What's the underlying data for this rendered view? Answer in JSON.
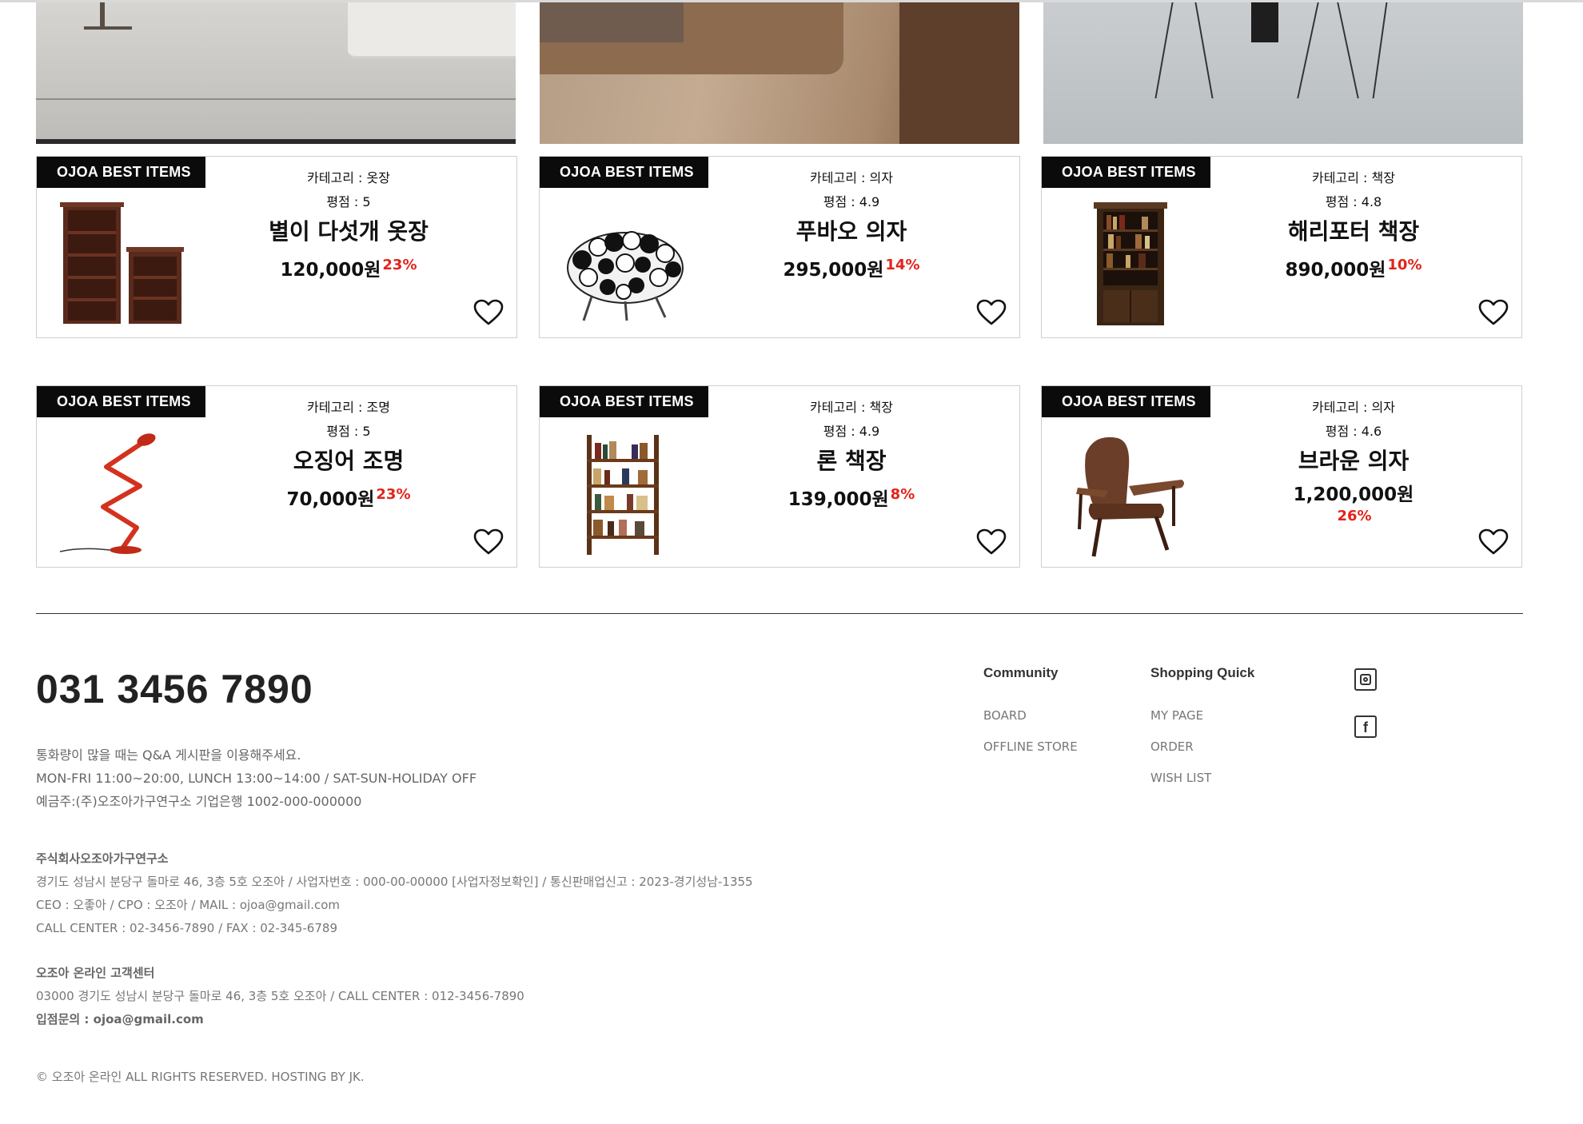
{
  "badge_label": "OJOA BEST ITEMS",
  "colors": {
    "discount": "#e2231a",
    "badge_bg": "#0b0b0b",
    "text": "#222222"
  },
  "products": [
    {
      "category": "카테고리 : 옷장",
      "rating": "평점 : 5",
      "name": "별이 다섯개 옷장",
      "price": "120,000원",
      "discount": "23%",
      "image": "bookcase-pair"
    },
    {
      "category": "카테고리 : 의자",
      "rating": "평점 : 4.9",
      "name": "푸바오 의자",
      "price": "295,000원",
      "discount": "14%",
      "image": "panda-chair"
    },
    {
      "category": "카테고리 : 책장",
      "rating": "평점 : 4.8",
      "name": "해리포터 책장",
      "price": "890,000원",
      "discount": "10%",
      "image": "antique-bookcase"
    },
    {
      "category": "카테고리 : 조명",
      "rating": "평점 : 5",
      "name": "오징어 조명",
      "price": "70,000원",
      "discount": "23%",
      "image": "zigzag-lamp"
    },
    {
      "category": "카테고리 : 책장",
      "rating": "평점 : 4.9",
      "name": "론 책장",
      "price": "139,000원",
      "discount": "8%",
      "image": "open-bookshelf"
    },
    {
      "category": "카테고리 : 의자",
      "rating": "평점 : 4.6",
      "name": "브라운 의자",
      "price": "1,200,000원",
      "discount": "26%",
      "image": "leather-armchair"
    }
  ],
  "footer": {
    "phone": "031 3456 7890",
    "notice": "통화량이 많을 때는 Q&A 게시판을 이용해주세요.",
    "hours": "MON-FRI 11:00~20:00, LUNCH 13:00~14:00 / SAT-SUN-HOLIDAY OFF",
    "bank": "예금주:(주)오조아가구연구소 기업은행 1002-000-000000",
    "company_name": "주식회사오조아가구연구소",
    "company_address": "경기도 성남시 분당구 돌마로 46, 3층 5호 오조아 / 사업자번호 : 000-00-00000 [사업자정보확인] / 통신판매업신고 : 2023-경기성남-1355",
    "company_ceo": "CEO : 오좋아 / CPO : 오조아 / MAIL : ojoa@gmail.com",
    "company_callcenter": "CALL CENTER : 02-3456-7890 / FAX : 02-345-6789",
    "cs_title": "오조아 온라인 고객센터",
    "cs_address": "03000 경기도 성남시 분당구 돌마로 46, 3층 5호 오조아 / CALL CENTER : 012-3456-7890",
    "cs_inquiry": "입점문의 : ojoa@gmail.com",
    "copyright": "© 오조아 온라인 ALL RIGHTS RESERVED. HOSTING BY JK.",
    "community": {
      "title": "Community",
      "links": [
        "BOARD",
        "OFFLINE STORE"
      ]
    },
    "shopping": {
      "title": "Shopping Quick",
      "links": [
        "MY PAGE",
        "ORDER",
        "WISH LIST"
      ]
    },
    "sns": [
      "instagram-icon",
      "facebook-icon"
    ]
  }
}
